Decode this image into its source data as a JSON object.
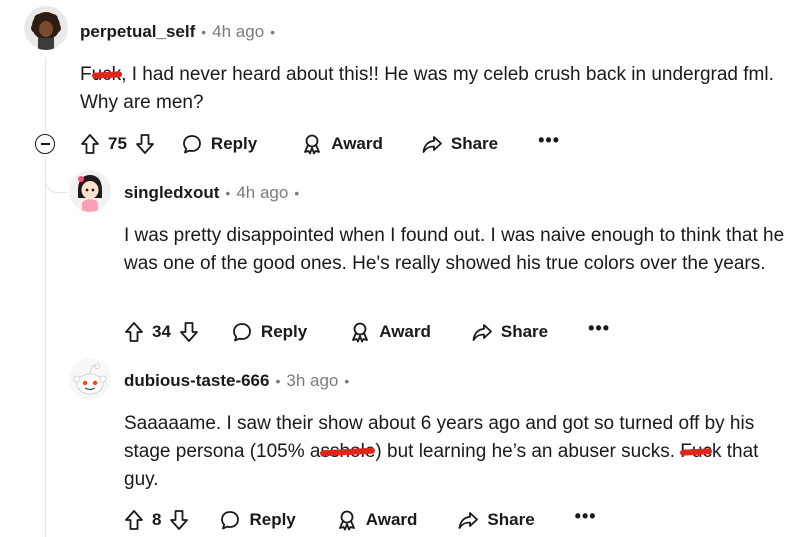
{
  "comments": [
    {
      "username": "perpetual_self",
      "time": "4h ago",
      "text_parts": {
        "c1": "F",
        "c2": "uck",
        "c3": ", I had never heard about this!! He was my celeb crush back in undergrad fml. Why are men?"
      },
      "votes": "75",
      "reply_label": "Reply",
      "award_label": "Award",
      "share_label": "Share",
      "more_label": "•••"
    },
    {
      "username": "singledxout",
      "time": "4h ago",
      "text": "I was pretty disappointed when I found out. I was naive enough to think that he was one of the good ones. He's really showed his true colors over the years.",
      "votes": "34",
      "reply_label": "Reply",
      "award_label": "Award",
      "share_label": "Share",
      "more_label": "•••"
    },
    {
      "username": "dubious-taste-666",
      "time": "3h ago",
      "text_parts": {
        "a": "Saaaaame. I saw their show about 6 years ago and got so turned off by his stage persona (105% a",
        "b": "sshole",
        "c": ") but learning he’s an abuser sucks. ",
        "d": "Fuc",
        "e": "k that guy."
      },
      "votes": "8",
      "reply_label": "Reply",
      "award_label": "Award",
      "share_label": "Share",
      "more_label": "•••"
    }
  ],
  "colors": {
    "text": "#1a1a1b",
    "meta": "#7c7c7c",
    "thread_line": "#e3e5e8",
    "censor_mark": "#e0251b"
  }
}
